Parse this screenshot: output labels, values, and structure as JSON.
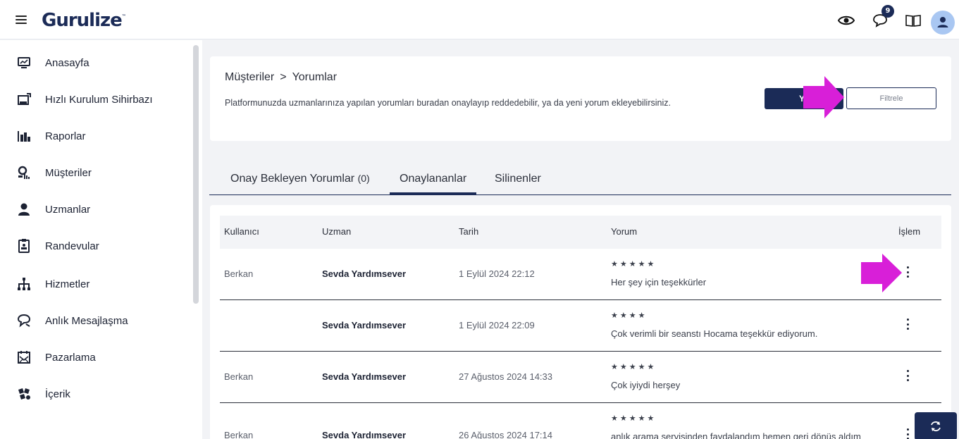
{
  "app": {
    "logo_text": "Gurulize",
    "logo_mark": "™"
  },
  "topbar": {
    "notification_count": "9",
    "icons": [
      "eye-icon",
      "chat-icon",
      "book-icon",
      "user-icon"
    ]
  },
  "sidebar": {
    "items": [
      {
        "label": "Anasayfa",
        "icon": "monitor-chart-icon"
      },
      {
        "label": "Hızlı Kurulum Sihirbazı",
        "icon": "setup-wizard-icon"
      },
      {
        "label": "Raporlar",
        "icon": "bar-chart-icon"
      },
      {
        "label": "Müşteriler",
        "icon": "customers-icon"
      },
      {
        "label": "Uzmanlar",
        "icon": "experts-icon"
      },
      {
        "label": "Randevular",
        "icon": "appointments-icon"
      },
      {
        "label": "Hizmetler",
        "icon": "services-icon"
      },
      {
        "label": "Anlık Mesajlaşma",
        "icon": "messaging-icon"
      },
      {
        "label": "Pazarlama",
        "icon": "marketing-icon"
      },
      {
        "label": "İçerik",
        "icon": "content-icon"
      }
    ]
  },
  "header": {
    "breadcrumb": [
      "Müşteriler",
      "Yorumlar"
    ],
    "breadcrumb_sep": ">",
    "description": "Platformunuzda uzmanlarınıza yapılan yorumları buradan onaylayıp reddedebilir, ya da yeni yorum ekleyebilirsiniz.",
    "new_button_label": "Ye",
    "filter_button_label": "Filtrele"
  },
  "tabs": [
    {
      "label": "Onay Bekleyen Yorumlar",
      "count": "(0)"
    },
    {
      "label": "Onaylananlar"
    },
    {
      "label": "Silinenler"
    }
  ],
  "table": {
    "columns": [
      "Kullanıcı",
      "Uzman",
      "Tarih",
      "Yorum",
      "İşlem"
    ],
    "rows": [
      {
        "user": "Berkan",
        "expert": "Sevda Yardımsever",
        "date": "1 Eylül 2024 22:12",
        "stars": "★★★★★",
        "comment": "Her şey için teşekkürler"
      },
      {
        "user": "",
        "expert": "Sevda Yardımsever",
        "date": "1 Eylül 2024 22:09",
        "stars": "★★★★",
        "comment": "Çok verimli bir seanstı Hocama teşekkür ediyorum."
      },
      {
        "user": "Berkan",
        "expert": "Sevda Yardımsever",
        "date": "27 Ağustos 2024 14:33",
        "stars": "★★★★★",
        "comment": "Çok iyiydi herşey"
      },
      {
        "user": "Berkan",
        "expert": "Sevda Yardımsever",
        "date": "26 Ağustos 2024 17:14",
        "stars": "★★★★★",
        "comment": "anlık arama servisinden faydalandım hemen geri dönüş aldım"
      }
    ]
  },
  "colors": {
    "brand": "#1b2b57",
    "arrow": "#d81fd8",
    "avatar": "#a9c7f2"
  }
}
